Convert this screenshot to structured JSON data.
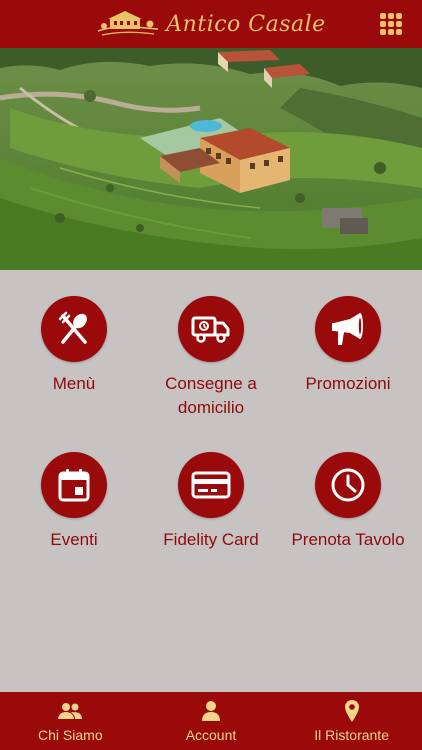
{
  "header": {
    "brand_name": "Antico Casale",
    "menu_icon": "grid-icon",
    "accent_color": "#9b0a0b",
    "gold_color": "#e9c368"
  },
  "hero": {
    "image": "aerial-farmhouse-photo"
  },
  "tiles": [
    {
      "label": "Menù",
      "icon": "fork-spoon-icon"
    },
    {
      "label": "Consegne a domicilio",
      "icon": "delivery-truck-icon"
    },
    {
      "label": "Promozioni",
      "icon": "megaphone-icon"
    },
    {
      "label": "Eventi",
      "icon": "calendar-icon"
    },
    {
      "label": "Fidelity Card",
      "icon": "credit-card-icon"
    },
    {
      "label": "Prenota Tavolo",
      "icon": "clock-icon"
    }
  ],
  "bottom_nav": [
    {
      "label": "Chi Siamo",
      "icon": "people-icon"
    },
    {
      "label": "Account",
      "icon": "person-icon"
    },
    {
      "label": "Il Ristorante",
      "icon": "map-pin-icon"
    }
  ]
}
